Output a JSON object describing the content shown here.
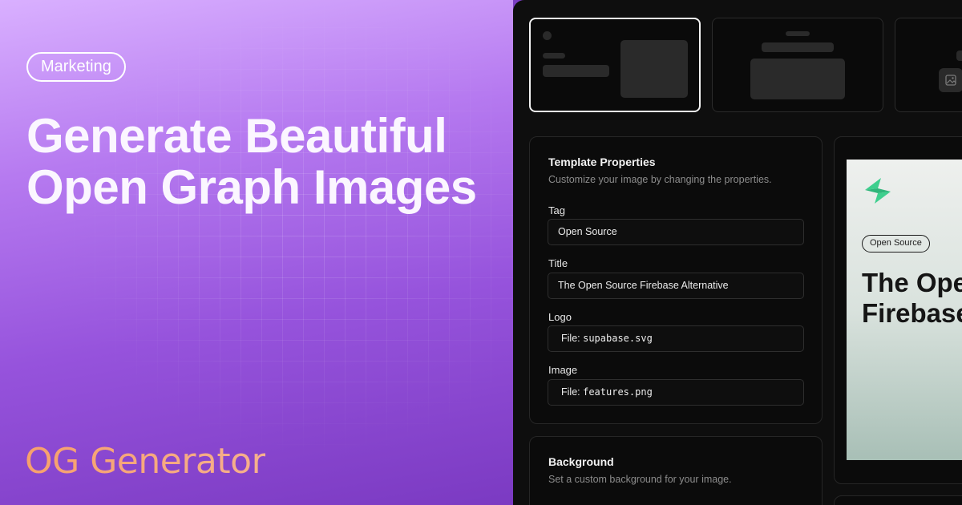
{
  "hero": {
    "tag": "Marketing",
    "headline": [
      "Generate Beautiful",
      "Open Graph Images"
    ],
    "brand": "OG Generator",
    "colors": {
      "gradient_top": "#d9b0ff",
      "gradient_bottom": "#7b3ac2",
      "brand": "#f7a06c"
    }
  },
  "app": {
    "template_properties": {
      "title": "Template Properties",
      "subtitle": "Customize your image by changing the properties.",
      "fields": [
        {
          "label": "Tag",
          "value": "Open Source"
        },
        {
          "label": "Title",
          "value": "The Open Source Firebase Alternative"
        },
        {
          "label": "Logo",
          "key": "File:",
          "value": "supabase.svg"
        },
        {
          "label": "Image",
          "key": "File:",
          "value": "features.png"
        }
      ]
    },
    "background": {
      "title": "Background",
      "subtitle": "Set a custom background for your image."
    },
    "preview": {
      "tag": "Open Source",
      "title_lines": [
        "The Open Source",
        "Firebase Alternative"
      ],
      "logo_icon": "supabase-logo-icon",
      "colors": {
        "logo": "#3ecf8e"
      }
    }
  }
}
